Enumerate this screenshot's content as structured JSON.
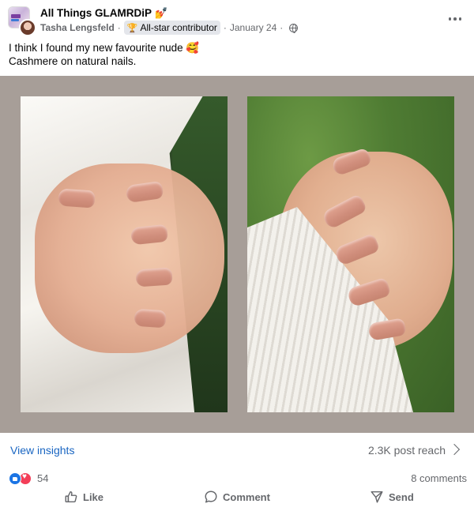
{
  "post": {
    "group_name": "All Things GLAMRDiP 💅",
    "author": "Tasha Lengsfeld",
    "badge_icon": "🏆",
    "badge_label": "All-star contributor",
    "date": "January 24",
    "text_line1": "I think I found my new favourite nude 🥰",
    "text_line2": "Cashmere on natural nails."
  },
  "insights": {
    "view_insights_label": "View insights",
    "reach_label": "2.3K post reach"
  },
  "engagement": {
    "reaction_count": "54",
    "comments_label": "8 comments"
  },
  "actions": {
    "like_label": "Like",
    "comment_label": "Comment",
    "send_label": "Send"
  },
  "colors": {
    "link_blue": "#1a66c2",
    "secondary_text": "#65676b",
    "media_background": "#a79e98",
    "like_blue": "#1b74e4",
    "love_red": "#f33e58"
  },
  "icons": [
    "more-icon",
    "globe-icon",
    "trophy-icon",
    "chevron-right-icon",
    "like-reaction-icon",
    "love-reaction-icon",
    "thumbs-up-icon",
    "comment-icon",
    "send-icon"
  ]
}
